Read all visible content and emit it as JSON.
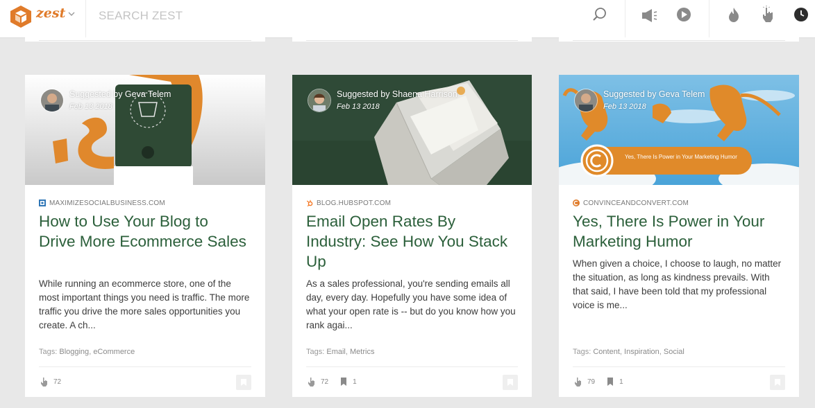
{
  "header": {
    "brand": "zest",
    "search_placeholder": "SEARCH ZEST"
  },
  "colors": {
    "brand_orange": "#e07b2a",
    "title_green": "#2b5f3a",
    "page_bg": "#e8e8e8"
  },
  "icons": {
    "logo": "zest-box-logo",
    "search": "search-icon",
    "toolbar": [
      "megaphone-icon",
      "play-icon",
      "fire-icon",
      "hand-pointer-icon",
      "clock-icon"
    ]
  },
  "cards": [
    {
      "suggested_by": "Suggested by Geva Telem",
      "date": "Feb 13 2018",
      "source": "MAXIMIZESOCIALBUSINESS.COM",
      "title": "How to Use Your Blog to Drive More Ecommerce Sales",
      "excerpt": "While running an ecommerce store, one of the most important things you need is traffic. The more traffic you drive the more sales opportunities you create. A ch...",
      "tags_label": "Tags:",
      "tags": [
        "Blogging",
        "eCommerce"
      ],
      "likes": "72",
      "saves": ""
    },
    {
      "suggested_by": "Suggested by Shaena Harrison",
      "date": "Feb 13 2018",
      "source": "BLOG.HUBSPOT.COM",
      "title": "Email Open Rates By Industry: See How You Stack Up",
      "excerpt": "As a sales professional, you're sending emails all day, every day. Hopefully you have some idea of what your open rate is -- but do you know how you rank agai...",
      "tags_label": "Tags:",
      "tags": [
        "Email",
        "Metrics"
      ],
      "likes": "72",
      "saves": "1"
    },
    {
      "suggested_by": "Suggested by Geva Telem",
      "date": "Feb 13 2018",
      "source": "CONVINCEANDCONVERT.COM",
      "title": "Yes, There Is Power in Your Marketing Humor",
      "excerpt": "When given a choice, I choose to laugh, no matter the situation, as long as kindness prevails. With that said, I have been told that my professional voice is me...",
      "tags_label": "Tags:",
      "tags": [
        "Content",
        "Inspiration",
        "Social"
      ],
      "likes": "79",
      "saves": "1",
      "image_text": "Yes, There Is Power in Your Marketing Humor"
    }
  ]
}
